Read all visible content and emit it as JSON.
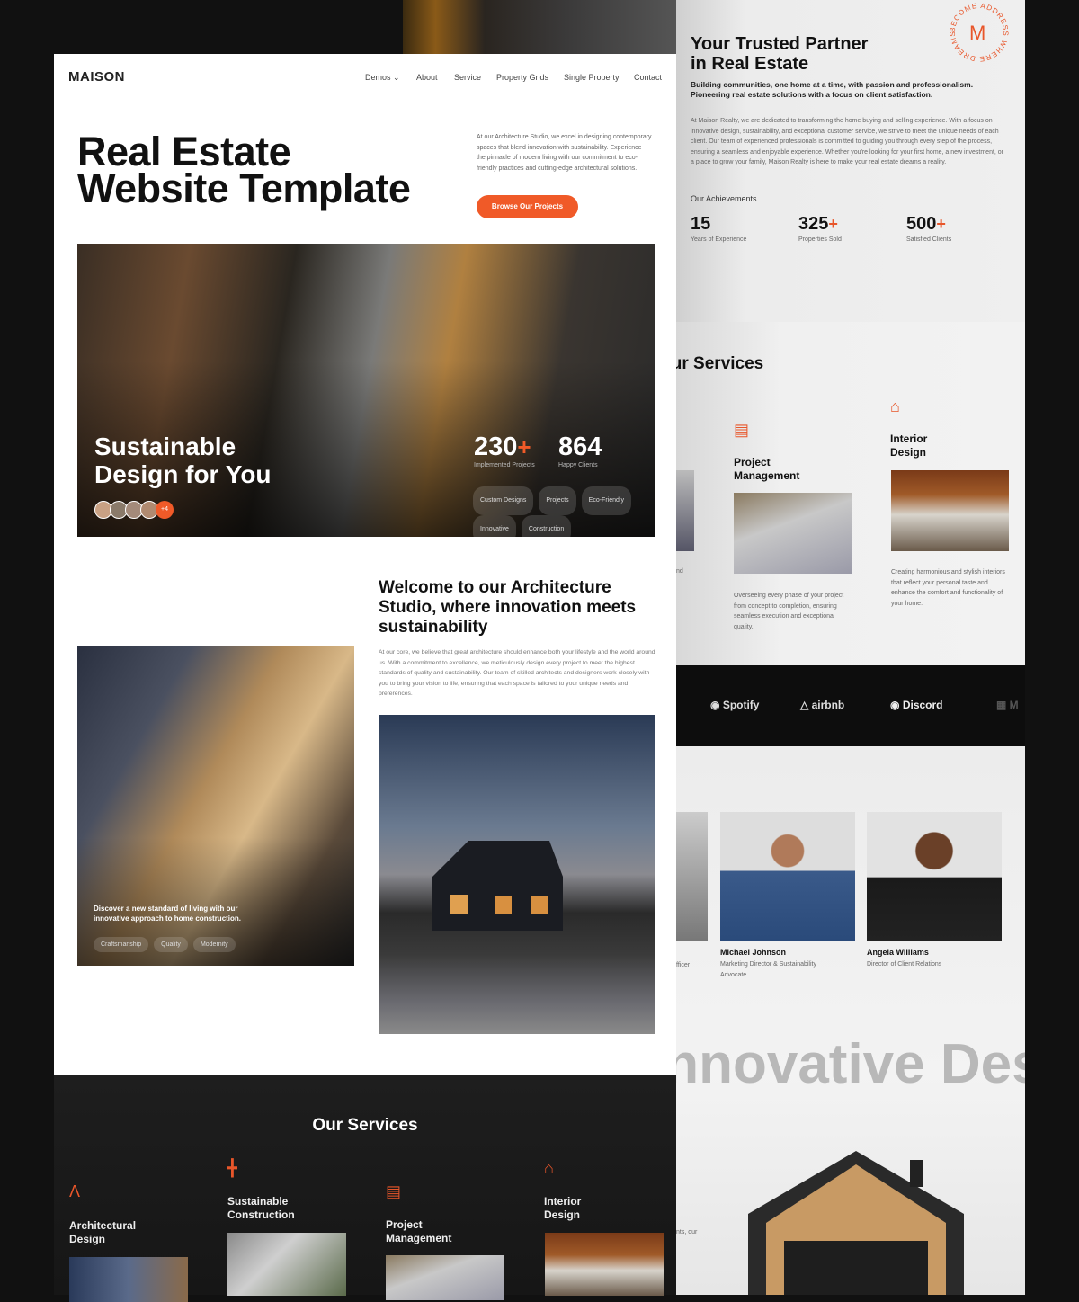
{
  "colors": {
    "accent": "#f05a28",
    "dark": "#111111"
  },
  "brand": "MAISON",
  "nav": [
    "Demos",
    "About",
    "Service",
    "Property Grids",
    "Single Property",
    "Contact"
  ],
  "hero": {
    "title_line1": "Real Estate",
    "title_line2": "Website Template",
    "description": "At our Architecture Studio, we excel in designing contemporary spaces that blend innovation with sustainability. Experience the pinnacle of modern living with our commitment to eco-friendly practices and cutting-edge architectural solutions.",
    "cta": "Browse Our Projects"
  },
  "banner": {
    "title_line1": "Sustainable",
    "title_line2": "Design for You",
    "avatars_more": "+4",
    "stat1_value": "230",
    "stat1_label": "Implemented Projects",
    "stat2_value": "864",
    "stat2_label": "Happy Clients",
    "plus": "+",
    "tags": [
      "Custom Designs",
      "Projects",
      "Eco-Friendly",
      "Innovative",
      "Construction"
    ]
  },
  "welcome": {
    "title": "Welcome to our Architecture Studio, where innovation meets sustainability",
    "body": "At our core, we believe that great architecture should enhance both your lifestyle and the world around us. With a commitment to excellence, we meticulously design every project to meet the highest standards of quality and sustainability. Our team of skilled architects and designers work closely with you to bring your vision to life, ensuring that each space is tailored to your unique needs and preferences.",
    "overlay_text": "Discover a new standard of living with our innovative approach to home construction.",
    "tags": [
      "Craftsmanship",
      "Quality",
      "Modernity"
    ]
  },
  "dark_services": {
    "title": "Our Services",
    "items": [
      "Architectural Design",
      "Sustainable Construction",
      "Project Management",
      "Interior Design"
    ]
  },
  "about": {
    "title_line1": "Your Trusted Partner",
    "title_line2": "in Real Estate",
    "seal_letter": "M",
    "seal_text": "BECOME ADDRESS WHERE DREAMS",
    "subtitle": "Building communities, one home at a time, with passion and professionalism. Pioneering real estate solutions with a focus on client satisfaction.",
    "body": "At Maison Realty, we are dedicated to transforming the home buying and selling experience. With a focus on innovative design, sustainability, and exceptional customer service, we strive to meet the unique needs of each client. Our team of experienced professionals is committed to guiding you through every step of the process, ensuring a seamless and enjoyable experience. Whether you're looking for your first home, a new investment, or a place to grow your family, Maison Realty is here to make your real estate dreams a reality.",
    "achievements_label": "Our Achievements",
    "stats": [
      {
        "value": "15",
        "plus": "",
        "label": "Years of Experience"
      },
      {
        "value": "325",
        "plus": "+",
        "label": "Properties Sold"
      },
      {
        "value": "500",
        "plus": "+",
        "label": "Satisfied Clients"
      }
    ]
  },
  "light_services": {
    "title": "Our Services",
    "items": [
      {
        "title": "Project Management",
        "desc": "Overseeing every phase of your project from concept to completion, ensuring seamless execution and exceptional quality."
      },
      {
        "title": "Interior Design",
        "desc": "Creating harmonious and stylish interiors that reflect your personal taste and enhance the comfort and functionality of your home."
      }
    ],
    "partial_text": "nd"
  },
  "partners": [
    "Spotify",
    "airbnb",
    "Discord",
    "M"
  ],
  "team": {
    "partial_role": "fficer",
    "members": [
      {
        "name": "Michael Johnson",
        "role": "Marketing Director & Sustainability Advocate"
      },
      {
        "name": "Angela Williams",
        "role": "Director of Client Relations"
      }
    ]
  },
  "marquee": "Innovative Design",
  "partial_text2": "nts, our"
}
